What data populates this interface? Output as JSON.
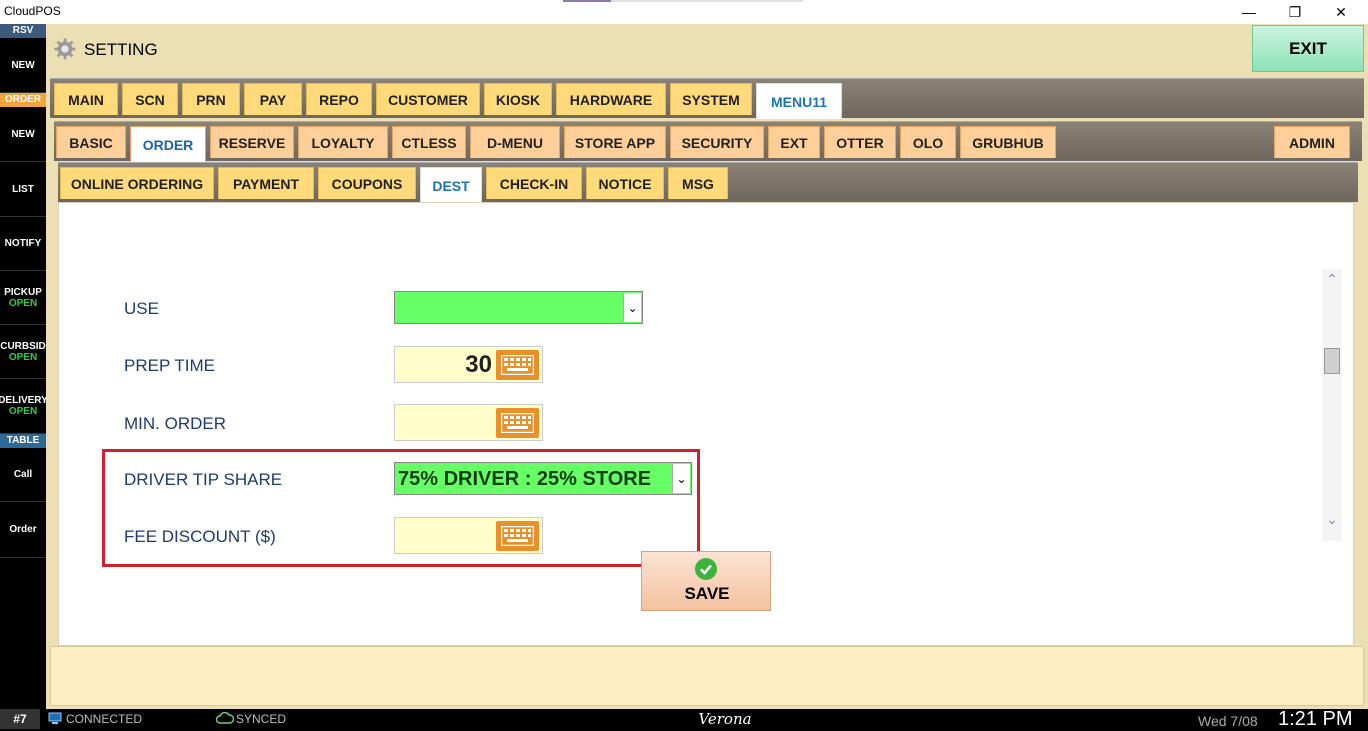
{
  "window": {
    "title": "CloudPOS",
    "minimize": "—",
    "maximize": "❐",
    "close": "✕"
  },
  "sidebar": {
    "rsv_header": "RSV",
    "order_header": "ORDER",
    "table_header": "TABLE",
    "items": [
      {
        "label": "NEW"
      },
      {
        "label": "NEW"
      },
      {
        "label": "LIST"
      },
      {
        "label": "NOTIFY"
      },
      {
        "label": "PICKUP",
        "status": "OPEN"
      },
      {
        "label": "CURBSID",
        "status": "OPEN"
      },
      {
        "label": "DELIVERY",
        "status": "OPEN"
      },
      {
        "label": "Call"
      },
      {
        "label": "Order"
      }
    ]
  },
  "header": {
    "title": "SETTING",
    "exit_label": "EXIT",
    "gear_icon": "gear-icon"
  },
  "tabs_level1": [
    "MAIN",
    "SCN",
    "PRN",
    "PAY",
    "REPO",
    "CUSTOMER",
    "KIOSK",
    "HARDWARE",
    "SYSTEM",
    "MENU11"
  ],
  "tabs_level1_active": "MENU11",
  "tabs_level2": [
    "BASIC",
    "ORDER",
    "RESERVE",
    "LOYALTY",
    "CTLESS",
    "D-MENU",
    "STORE APP",
    "SECURITY",
    "EXT",
    "OTTER",
    "OLO",
    "GRUBHUB",
    "ADMIN"
  ],
  "tabs_level2_active": "ORDER",
  "tabs_level3": [
    "ONLINE ORDERING",
    "PAYMENT",
    "COUPONS",
    "DEST",
    "CHECK-IN",
    "NOTICE",
    "MSG"
  ],
  "tabs_level3_active": "DEST",
  "form": {
    "use_label": "USE",
    "use_value": "",
    "prep_time_label": "PREP TIME",
    "prep_time_value": "30",
    "min_order_label": "MIN. ORDER",
    "min_order_value": "",
    "driver_tip_label": "DRIVER TIP SHARE",
    "driver_tip_value": "75% DRIVER : 25% STORE",
    "fee_discount_label": "FEE DISCOUNT ($)",
    "fee_discount_value": ""
  },
  "save_label": "SAVE",
  "status": {
    "terminal": "#7",
    "connection": "CONNECTED",
    "sync": "SYNCED",
    "store": "Verona",
    "date": "Wed 7/08",
    "time": "1:21 PM"
  },
  "colors": {
    "select_green": "#66ff66",
    "highlight_red": "#d0202a",
    "tab_yellow": "#ffd97a",
    "accent_blue": "#1b76b2"
  }
}
